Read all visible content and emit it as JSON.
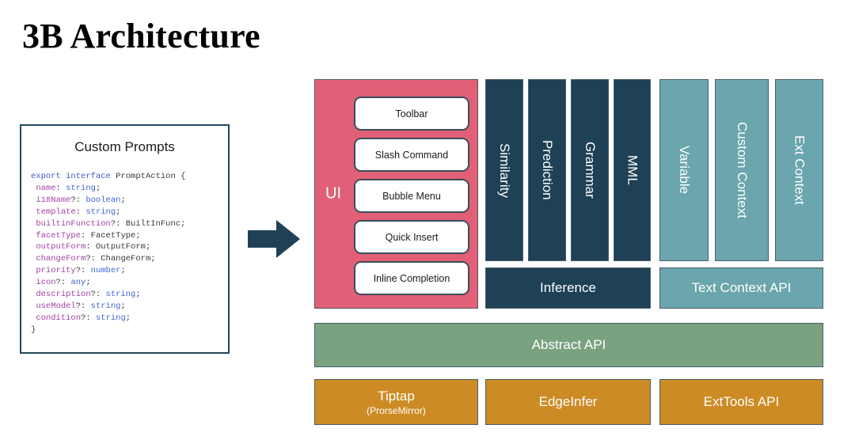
{
  "title": "3B Architecture",
  "code_card": {
    "title": "Custom Prompts",
    "lines": [
      [
        {
          "t": "export",
          "c": "kw"
        },
        {
          "t": " ",
          "c": "pun"
        },
        {
          "t": "interface",
          "c": "kw"
        },
        {
          "t": " ",
          "c": "pun"
        },
        {
          "t": "PromptAction",
          "c": "cls"
        },
        {
          "t": " {",
          "c": "pun"
        }
      ],
      [
        {
          "t": " ",
          "c": "pun"
        },
        {
          "t": "name",
          "c": "prop"
        },
        {
          "t": ": ",
          "c": "pun"
        },
        {
          "t": "string",
          "c": "type"
        },
        {
          "t": ";",
          "c": "pun"
        }
      ],
      [
        {
          "t": " ",
          "c": "pun"
        },
        {
          "t": "i18Name",
          "c": "prop"
        },
        {
          "t": "?: ",
          "c": "pun"
        },
        {
          "t": "boolean",
          "c": "type"
        },
        {
          "t": ";",
          "c": "pun"
        }
      ],
      [
        {
          "t": " ",
          "c": "pun"
        },
        {
          "t": "template",
          "c": "prop"
        },
        {
          "t": ": ",
          "c": "pun"
        },
        {
          "t": "string",
          "c": "type"
        },
        {
          "t": ";",
          "c": "pun"
        }
      ],
      [
        {
          "t": " ",
          "c": "pun"
        },
        {
          "t": "builtinFunction",
          "c": "prop"
        },
        {
          "t": "?: ",
          "c": "pun"
        },
        {
          "t": "BuiltInFunc",
          "c": "cls"
        },
        {
          "t": ";",
          "c": "pun"
        }
      ],
      [
        {
          "t": " ",
          "c": "pun"
        },
        {
          "t": "facetType",
          "c": "prop"
        },
        {
          "t": ": ",
          "c": "pun"
        },
        {
          "t": "FacetType",
          "c": "cls"
        },
        {
          "t": ";",
          "c": "pun"
        }
      ],
      [
        {
          "t": " ",
          "c": "pun"
        },
        {
          "t": "outputForm",
          "c": "prop"
        },
        {
          "t": ": ",
          "c": "pun"
        },
        {
          "t": "OutputForm",
          "c": "cls"
        },
        {
          "t": ";",
          "c": "pun"
        }
      ],
      [
        {
          "t": " ",
          "c": "pun"
        },
        {
          "t": "changeForm",
          "c": "prop"
        },
        {
          "t": "?: ",
          "c": "pun"
        },
        {
          "t": "ChangeForm",
          "c": "cls"
        },
        {
          "t": ";",
          "c": "pun"
        }
      ],
      [
        {
          "t": " ",
          "c": "pun"
        },
        {
          "t": "priority",
          "c": "prop"
        },
        {
          "t": "?: ",
          "c": "pun"
        },
        {
          "t": "number",
          "c": "type"
        },
        {
          "t": ";",
          "c": "pun"
        }
      ],
      [
        {
          "t": " ",
          "c": "pun"
        },
        {
          "t": "icon",
          "c": "prop"
        },
        {
          "t": "?: ",
          "c": "pun"
        },
        {
          "t": "any",
          "c": "type"
        },
        {
          "t": ";",
          "c": "pun"
        }
      ],
      [
        {
          "t": " ",
          "c": "pun"
        },
        {
          "t": "description",
          "c": "prop"
        },
        {
          "t": "?: ",
          "c": "pun"
        },
        {
          "t": "string",
          "c": "type"
        },
        {
          "t": ";",
          "c": "pun"
        }
      ],
      [
        {
          "t": " ",
          "c": "pun"
        },
        {
          "t": "useModel",
          "c": "prop"
        },
        {
          "t": "?: ",
          "c": "pun"
        },
        {
          "t": "string",
          "c": "type"
        },
        {
          "t": ";",
          "c": "pun"
        }
      ],
      [
        {
          "t": " ",
          "c": "pun"
        },
        {
          "t": "condition",
          "c": "prop"
        },
        {
          "t": "?: ",
          "c": "pun"
        },
        {
          "t": "string",
          "c": "type"
        },
        {
          "t": ";",
          "c": "pun"
        }
      ],
      [
        {
          "t": "}",
          "c": "pun"
        }
      ]
    ]
  },
  "arrow": {
    "name": "right-arrow",
    "color": "#1f4155"
  },
  "ui_panel": {
    "label": "UI",
    "color": "#e16077",
    "items": [
      {
        "label": "Toolbar"
      },
      {
        "label": "Slash Command"
      },
      {
        "label": "Bubble Menu"
      },
      {
        "label": "Quick Insert"
      },
      {
        "label": "Inline Completion"
      }
    ]
  },
  "inference_columns": {
    "color": "#1f4155",
    "items": [
      {
        "label": "Similarity"
      },
      {
        "label": "Prediction"
      },
      {
        "label": "Grammar"
      },
      {
        "label": "MML"
      }
    ],
    "footer": {
      "label": "Inference"
    }
  },
  "context_columns": {
    "color": "#6ba5ad",
    "items": [
      {
        "label": "Variable"
      },
      {
        "label": "Custom Context"
      },
      {
        "label": "Ext Context"
      }
    ],
    "footer": {
      "label": "Text Context API"
    }
  },
  "abstract_api": {
    "label": "Abstract API",
    "color": "#7aa281"
  },
  "foundation": {
    "color": "#cd8b25",
    "items": [
      {
        "label": "Tiptap",
        "sublabel": "(ProrseMirror)"
      },
      {
        "label": "EdgeInfer",
        "sublabel": ""
      },
      {
        "label": "ExtTools API",
        "sublabel": ""
      }
    ]
  }
}
